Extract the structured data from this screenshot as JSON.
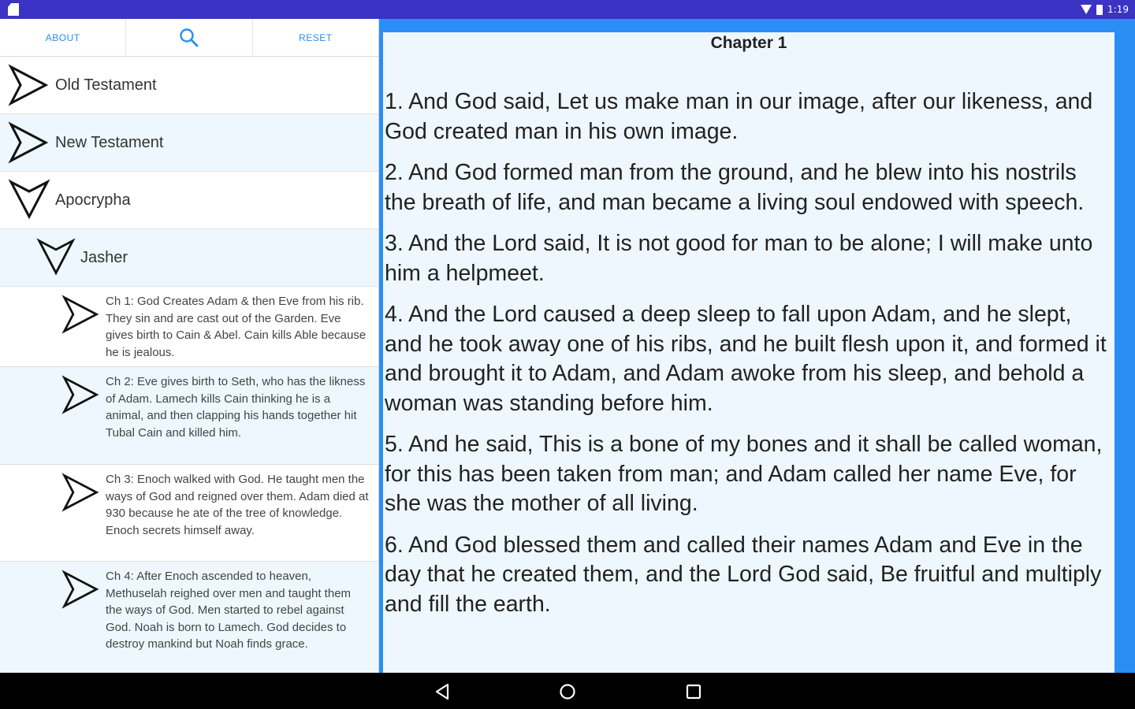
{
  "status_bar": {
    "time": "1:19",
    "icons": [
      "sim-icon",
      "wifi-icon",
      "battery-icon"
    ]
  },
  "toolbar": {
    "about_label": "ABOUT",
    "search_icon": "search-icon",
    "reset_label": "RESET",
    "accent_color": "#2a8cf2"
  },
  "tree": {
    "old_testament": "Old Testament",
    "new_testament": "New Testament",
    "apocrypha": "Apocrypha",
    "jasher": "Jasher",
    "chapters": [
      "Ch 1: God Creates Adam & then Eve from his rib.  They sin and are cast out of the Garden.  Eve gives birth to Cain & Abel.  Cain kills Able because he is jealous.",
      "Ch 2: Eve gives birth to Seth, who has the likness of Adam. Lamech kills Cain thinking he is a animal, and then clapping his hands together hit Tubal Cain and killed him.",
      "Ch 3: Enoch walked with God. He taught men the ways of God and reigned over them.  Adam died at 930 because he ate of the tree of knowledge. Enoch secrets himself away.",
      "Ch 4: After Enoch ascended to heaven, Methuselah reighed over men and taught them the ways of God.  Men started to rebel against God.  Noah is born to Lamech.  God decides to destroy mankind but Noah finds grace."
    ]
  },
  "reader": {
    "chapter_title": "Chapter 1",
    "verses": [
      "1. And God said, Let us make man in our image, after our likeness, and God created man in his own image.",
      "2. And God formed man from the ground, and he blew into his nostrils the breath of life, and man became a living soul endowed with speech.",
      "3. And the Lord said, It is not good for man to be alone; I will make unto him a helpmeet.",
      "4. And the Lord caused a deep sleep to fall upon Adam, and he slept, and he took away one of his ribs, and he built flesh upon it, and formed it and brought it to Adam, and Adam awoke from his sleep, and behold a woman was standing before him.",
      "5. And he said, This is a bone of my bones and it shall be called woman, for this has been taken from man; and Adam called her name Eve, for she was the mother of all living.",
      "6. And God blessed them and called their names Adam and Eve in the day that he created them, and the Lord God said, Be fruitful and multiply and fill the earth."
    ],
    "frame_color": "#2b8ef5",
    "background_color": "#eef7fd"
  },
  "nav_bar": {
    "icons": [
      "back-icon",
      "home-icon",
      "recents-icon"
    ]
  }
}
